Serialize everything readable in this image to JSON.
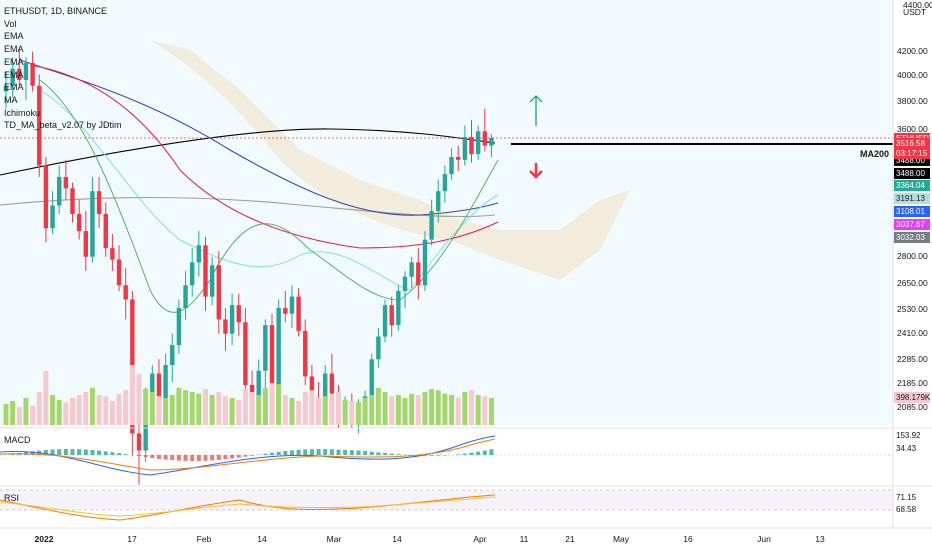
{
  "chart_data": {
    "type": "candlestick",
    "title": "ETHUSDT, 1D, BINANCE",
    "currency": "USDT",
    "indicators": [
      "Vol",
      "EMA",
      "EMA",
      "EMA",
      "EMA",
      "EMA",
      "MA",
      "Ichimoku",
      "TD_MA_beta_v2.07 by JDtim"
    ],
    "price_axis_ticks": [
      "4200.00",
      "4000.00",
      "3800.00",
      "3600.00",
      "3400.00",
      "2800.00",
      "2650.00",
      "2530.00",
      "2410.00",
      "2285.00",
      "2185.00",
      "2085.00"
    ],
    "price_axis_top_label": "4400.00",
    "time_axis_ticks": [
      "2022",
      "17",
      "Feb",
      "14",
      "Mar",
      "14",
      "Apr",
      "11",
      "21",
      "May",
      "16",
      "Jun",
      "13"
    ],
    "last_price": {
      "symbol": "ETHUSDT",
      "value": "3516.58",
      "countdown": "03:17:15"
    },
    "price_labels": [
      {
        "value": "3488.00",
        "color": "#000000"
      },
      {
        "value": "3488.00",
        "color": "#000000"
      },
      {
        "value": "3364.04",
        "color": "#22ab94"
      },
      {
        "value": "3191.13",
        "color": "#b2dfdb"
      },
      {
        "value": "3108.01",
        "color": "#2962ff"
      },
      {
        "value": "3037.67",
        "color": "#e040fb"
      },
      {
        "value": "3032.03",
        "color": "#787b86"
      }
    ],
    "annotation": "MA200",
    "volume_label": "398.179K",
    "candles": [
      [
        3680,
        3750,
        3620,
        3700
      ],
      [
        3700,
        3800,
        3660,
        3760
      ],
      [
        3760,
        3830,
        3700,
        3720
      ],
      [
        3720,
        3800,
        3650,
        3780
      ],
      [
        3780,
        3820,
        3680,
        3700
      ],
      [
        3700,
        3740,
        3380,
        3420
      ],
      [
        3420,
        3450,
        3150,
        3200
      ],
      [
        3200,
        3330,
        3180,
        3280
      ],
      [
        3280,
        3420,
        3250,
        3380
      ],
      [
        3380,
        3440,
        3300,
        3340
      ],
      [
        3340,
        3360,
        3220,
        3250
      ],
      [
        3250,
        3300,
        3160,
        3190
      ],
      [
        3190,
        3260,
        3050,
        3100
      ],
      [
        3100,
        3380,
        3080,
        3330
      ],
      [
        3330,
        3380,
        3200,
        3250
      ],
      [
        3250,
        3290,
        3100,
        3130
      ],
      [
        3130,
        3180,
        3050,
        3090
      ],
      [
        3090,
        3140,
        2980,
        3000
      ],
      [
        3000,
        3060,
        2880,
        2950
      ],
      [
        2950,
        2980,
        2400,
        2480
      ],
      [
        2480,
        2620,
        2300,
        2420
      ],
      [
        2420,
        2640,
        2380,
        2580
      ],
      [
        2580,
        2720,
        2540,
        2690
      ],
      [
        2690,
        2740,
        2540,
        2600
      ],
      [
        2600,
        2760,
        2590,
        2720
      ],
      [
        2720,
        2830,
        2660,
        2790
      ],
      [
        2790,
        2950,
        2760,
        2920
      ],
      [
        2920,
        3050,
        2880,
        3000
      ],
      [
        3000,
        3130,
        2960,
        3080
      ],
      [
        3080,
        3190,
        3030,
        3140
      ],
      [
        3140,
        3170,
        2910,
        2960
      ],
      [
        2960,
        3100,
        2930,
        3070
      ],
      [
        3070,
        3120,
        2830,
        2880
      ],
      [
        2880,
        2920,
        2770,
        2830
      ],
      [
        2830,
        2970,
        2790,
        2930
      ],
      [
        2930,
        2970,
        2820,
        2870
      ],
      [
        2870,
        2920,
        2620,
        2650
      ],
      [
        2650,
        2700,
        2570,
        2600
      ],
      [
        2600,
        2740,
        2560,
        2700
      ],
      [
        2700,
        2880,
        2640,
        2860
      ],
      [
        2860,
        2900,
        2660,
        2620
      ],
      [
        2620,
        2950,
        2600,
        2920
      ],
      [
        2920,
        2980,
        2870,
        2900
      ],
      [
        2900,
        3000,
        2850,
        2960
      ],
      [
        2960,
        2990,
        2820,
        2840
      ],
      [
        2840,
        2880,
        2650,
        2680
      ],
      [
        2680,
        2720,
        2570,
        2600
      ],
      [
        2600,
        2660,
        2540,
        2580
      ],
      [
        2580,
        2720,
        2550,
        2690
      ],
      [
        2690,
        2760,
        2580,
        2620
      ],
      [
        2620,
        2650,
        2500,
        2550
      ],
      [
        2550,
        2610,
        2520,
        2590
      ],
      [
        2590,
        2620,
        2500,
        2530
      ],
      [
        2530,
        2600,
        2480,
        2560
      ],
      [
        2560,
        2630,
        2530,
        2610
      ],
      [
        2610,
        2760,
        2590,
        2740
      ],
      [
        2740,
        2850,
        2710,
        2820
      ],
      [
        2820,
        2950,
        2800,
        2930
      ],
      [
        2930,
        2960,
        2820,
        2860
      ],
      [
        2860,
        3000,
        2840,
        2980
      ],
      [
        2980,
        3050,
        2920,
        3030
      ],
      [
        3030,
        3100,
        2990,
        3080
      ],
      [
        3080,
        3130,
        2950,
        3000
      ],
      [
        3000,
        3190,
        2980,
        3160
      ],
      [
        3160,
        3300,
        3140,
        3260
      ],
      [
        3260,
        3370,
        3220,
        3330
      ],
      [
        3330,
        3420,
        3290,
        3390
      ],
      [
        3390,
        3480,
        3370,
        3450
      ],
      [
        3450,
        3490,
        3400,
        3440
      ],
      [
        3440,
        3560,
        3420,
        3520
      ],
      [
        3520,
        3580,
        3430,
        3460
      ],
      [
        3460,
        3560,
        3440,
        3540
      ],
      [
        3540,
        3620,
        3470,
        3490
      ],
      [
        3490,
        3530,
        3450,
        3517
      ]
    ],
    "volume_levels": [
      0.35,
      0.4,
      0.3,
      0.45,
      0.32,
      0.55,
      0.9,
      0.5,
      0.42,
      0.38,
      0.45,
      0.5,
      0.55,
      0.62,
      0.5,
      0.48,
      0.4,
      0.52,
      0.58,
      1.0,
      0.85,
      0.6,
      0.55,
      0.48,
      0.45,
      0.5,
      0.62,
      0.58,
      0.55,
      0.52,
      0.6,
      0.5,
      0.55,
      0.48,
      0.45,
      0.42,
      0.6,
      0.55,
      0.5,
      0.62,
      0.7,
      0.68,
      0.5,
      0.45,
      0.4,
      0.55,
      0.58,
      0.45,
      0.48,
      0.5,
      0.55,
      0.42,
      0.4,
      0.38,
      0.45,
      0.5,
      0.62,
      0.55,
      0.48,
      0.5,
      0.45,
      0.52,
      0.5,
      0.55,
      0.6,
      0.58,
      0.52,
      0.5,
      0.45,
      0.55,
      0.58,
      0.5,
      0.48,
      0.45
    ],
    "macd": {
      "values": [
        "153.92",
        "34.43"
      ],
      "colors": [
        "#f57c00",
        "#2962ff"
      ]
    },
    "rsi": {
      "values": [
        "71.15",
        "68.58"
      ],
      "colors": [
        "#f57c00",
        "#fbc02d"
      ]
    }
  },
  "ui": {
    "macd_label": "MACD",
    "rsi_label": "RSI"
  }
}
